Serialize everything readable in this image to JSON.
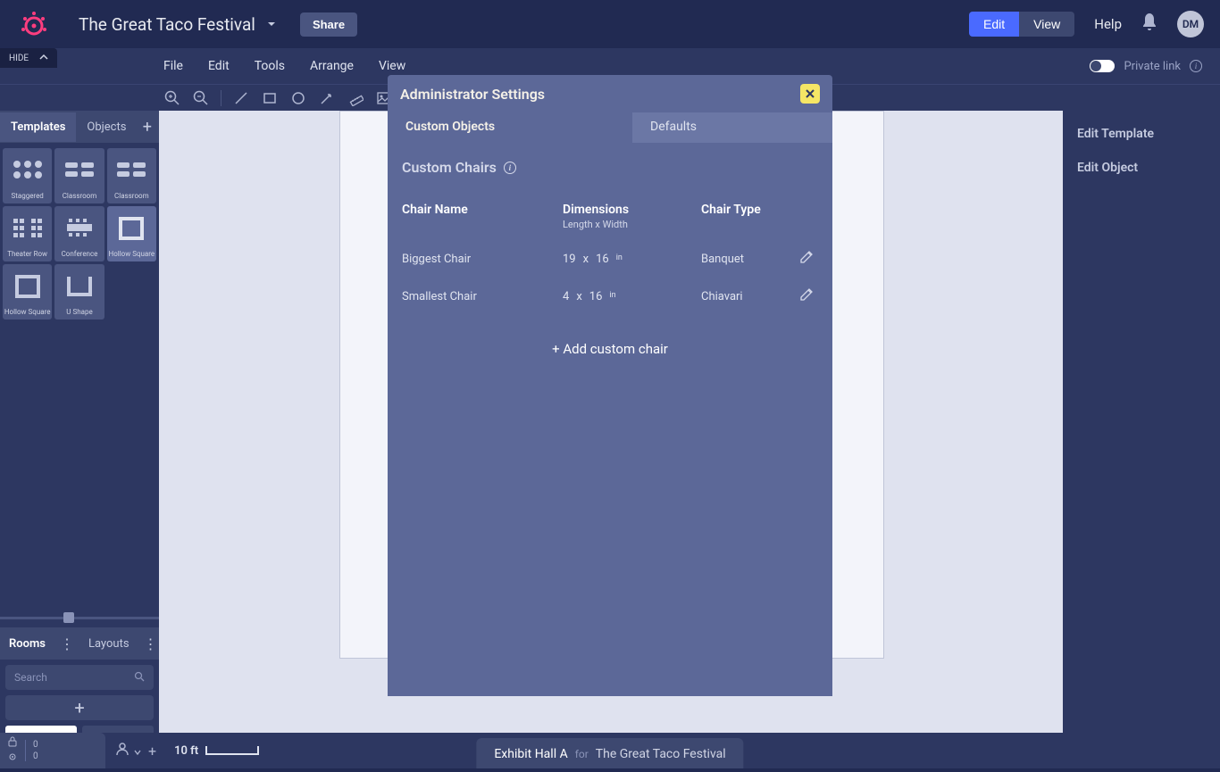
{
  "header": {
    "project_title": "The Great Taco Festival",
    "share_label": "Share",
    "edit_label": "Edit",
    "view_label": "View",
    "help_label": "Help",
    "avatar_initials": "DM"
  },
  "hide_tab": "HIDE",
  "menu": {
    "file": "File",
    "edit": "Edit",
    "tools": "Tools",
    "arrange": "Arrange",
    "view": "View",
    "private_link": "Private link"
  },
  "sidebar": {
    "templates_tab": "Templates",
    "objects_tab": "Objects",
    "templates": [
      {
        "label": "Staggered"
      },
      {
        "label": "Classroom"
      },
      {
        "label": "Classroom"
      },
      {
        "label": "Theater Row"
      },
      {
        "label": "Conference"
      },
      {
        "label": "Hollow Square"
      },
      {
        "label": "Hollow Square"
      },
      {
        "label": "U Shape"
      }
    ],
    "rooms_tab": "Rooms",
    "layouts_tab": "Layouts",
    "search_placeholder": "Search"
  },
  "right_sidebar": {
    "edit_template": "Edit Template",
    "edit_object": "Edit Object"
  },
  "bottom": {
    "lock_count": "0",
    "gear_count": "0",
    "scale_label": "10 ft"
  },
  "footer": {
    "hall": "Exhibit Hall A",
    "for_text": "for",
    "event": "The Great Taco Festival"
  },
  "modal": {
    "title": "Administrator Settings",
    "tab_custom": "Custom Objects",
    "tab_defaults": "Defaults",
    "section_title": "Custom Chairs",
    "col_name": "Chair Name",
    "col_dims": "Dimensions",
    "col_dims_sub": "Length x Width",
    "col_type": "Chair Type",
    "rows": [
      {
        "name": "Biggest Chair",
        "len": "19",
        "x": "x",
        "wid": "16",
        "unit": "in",
        "type": "Banquet"
      },
      {
        "name": "Smallest Chair",
        "len": "4",
        "x": "x",
        "wid": "16",
        "unit": "in",
        "type": "Chiavari"
      }
    ],
    "add_chair": "+ Add custom chair"
  }
}
